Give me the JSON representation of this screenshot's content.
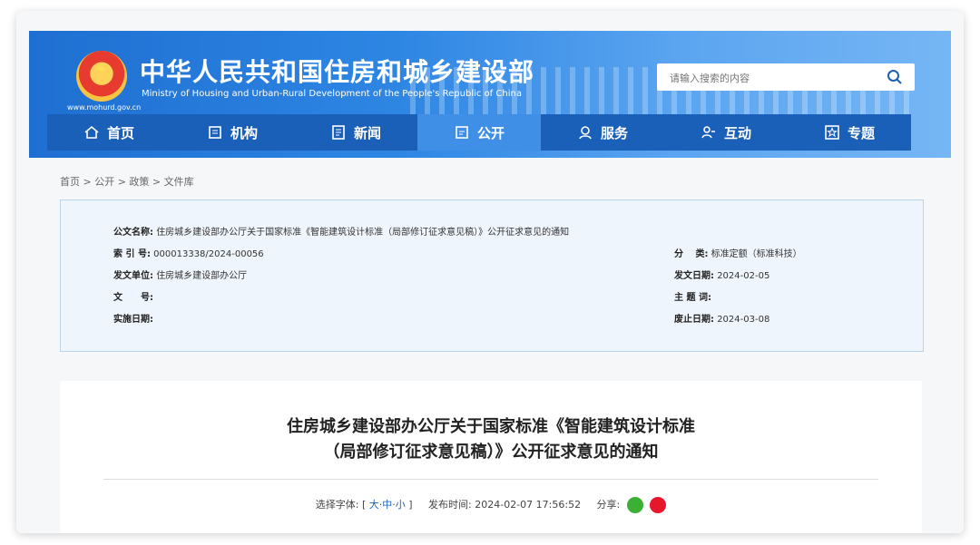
{
  "header": {
    "title_cn": "中华人民共和国住房和城乡建设部",
    "title_en": "Ministry of Housing and Urban-Rural Development of the People's Republic of China",
    "site_url": "www.mohurd.gov.cn",
    "search_placeholder": "请输入搜索的内容"
  },
  "nav": {
    "items": [
      {
        "label": "首页",
        "icon": "home-icon"
      },
      {
        "label": "机构",
        "icon": "building-icon"
      },
      {
        "label": "新闻",
        "icon": "news-icon"
      },
      {
        "label": "公开",
        "icon": "document-icon"
      },
      {
        "label": "服务",
        "icon": "service-icon"
      },
      {
        "label": "互动",
        "icon": "interaction-icon"
      },
      {
        "label": "专题",
        "icon": "star-icon"
      }
    ],
    "active_index": 3
  },
  "breadcrumb": "首页 > 公开 > 政策 > 文件库",
  "info": {
    "doc_name_label": "公文名称:",
    "doc_name": "住房城乡建设部办公厅关于国家标准《智能建筑设计标准（局部修订征求意见稿）》公开征求意见的通知",
    "index_label": "索 引 号:",
    "index_value": "000013338/2024-00056",
    "category_label": "分　 类:",
    "category_value": "标准定额（标准科技）",
    "issuer_label": "发文单位:",
    "issuer_value": "住房城乡建设部办公厅",
    "issue_date_label": "发文日期:",
    "issue_date_value": "2024-02-05",
    "doc_no_label": "文　　号:",
    "doc_no_value": "",
    "topic_label": "主 题 词:",
    "topic_value": "",
    "impl_date_label": "实施日期:",
    "impl_date_value": "",
    "expire_date_label": "废止日期:",
    "expire_date_value": "2024-03-08"
  },
  "document": {
    "title_line1": "住房城乡建设部办公厅关于国家标准《智能建筑设计标准",
    "title_line2": "（局部修订征求意见稿）》公开征求意见的通知",
    "font_label": "选择字体:",
    "font_open": "[",
    "font_large": "大",
    "font_medium": "中",
    "font_small": "小",
    "font_close": "]",
    "publish_label": "发布时间:",
    "publish_time": "2024-02-07 17:56:52",
    "share_label": "分享:"
  },
  "colors": {
    "nav_bg": "#1a5fb8",
    "nav_active": "#3f8fe6",
    "link": "#1a5fb8"
  }
}
